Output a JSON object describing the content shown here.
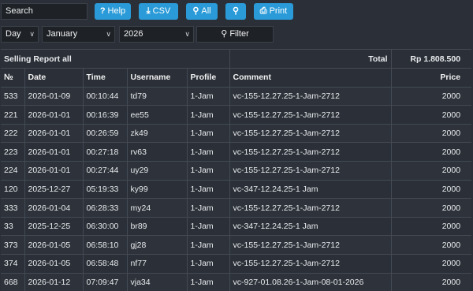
{
  "toolbar": {
    "search_value": "Search",
    "help_label": "Help",
    "csv_label": "CSV",
    "all_label": "All",
    "print_label": "Print"
  },
  "filters": {
    "period": "Day",
    "month": "January",
    "year": "2026",
    "filter_label": "Filter"
  },
  "report": {
    "title": "Selling Report all",
    "total_label": "Total",
    "total_value": "Rp 1.808.500"
  },
  "columns": {
    "no": "№",
    "date": "Date",
    "time": "Time",
    "username": "Username",
    "profile": "Profile",
    "comment": "Comment",
    "price": "Price"
  },
  "rows": [
    {
      "no": "533",
      "date": "2026-01-09",
      "time": "00:10:44",
      "username": "td79",
      "profile": "1-Jam",
      "comment": "vc-155-12.27.25-1-Jam-2712",
      "price": "2000"
    },
    {
      "no": "221",
      "date": "2026-01-01",
      "time": "00:16:39",
      "username": "ee55",
      "profile": "1-Jam",
      "comment": "vc-155-12.27.25-1-Jam-2712",
      "price": "2000"
    },
    {
      "no": "222",
      "date": "2026-01-01",
      "time": "00:26:59",
      "username": "zk49",
      "profile": "1-Jam",
      "comment": "vc-155-12.27.25-1-Jam-2712",
      "price": "2000"
    },
    {
      "no": "223",
      "date": "2026-01-01",
      "time": "00:27:18",
      "username": "rv63",
      "profile": "1-Jam",
      "comment": "vc-155-12.27.25-1-Jam-2712",
      "price": "2000"
    },
    {
      "no": "224",
      "date": "2026-01-01",
      "time": "00:27:44",
      "username": "uy29",
      "profile": "1-Jam",
      "comment": "vc-155-12.27.25-1-Jam-2712",
      "price": "2000"
    },
    {
      "no": "120",
      "date": "2025-12-27",
      "time": "05:19:33",
      "username": "ky99",
      "profile": "1-Jam",
      "comment": "vc-347-12.24.25-1 Jam",
      "price": "2000"
    },
    {
      "no": "333",
      "date": "2026-01-04",
      "time": "06:28:33",
      "username": "my24",
      "profile": "1-Jam",
      "comment": "vc-155-12.27.25-1-Jam-2712",
      "price": "2000"
    },
    {
      "no": "33",
      "date": "2025-12-25",
      "time": "06:30:00",
      "username": "br89",
      "profile": "1-Jam",
      "comment": "vc-347-12.24.25-1 Jam",
      "price": "2000"
    },
    {
      "no": "373",
      "date": "2026-01-05",
      "time": "06:58:10",
      "username": "gj28",
      "profile": "1-Jam",
      "comment": "vc-155-12.27.25-1-Jam-2712",
      "price": "2000"
    },
    {
      "no": "374",
      "date": "2026-01-05",
      "time": "06:58:48",
      "username": "nf77",
      "profile": "1-Jam",
      "comment": "vc-155-12.27.25-1-Jam-2712",
      "price": "2000"
    },
    {
      "no": "668",
      "date": "2026-01-12",
      "time": "07:09:47",
      "username": "vja34",
      "profile": "1-Jam",
      "comment": "vc-927-01.08.26-1-Jam-08-01-2026",
      "price": "2000"
    }
  ]
}
